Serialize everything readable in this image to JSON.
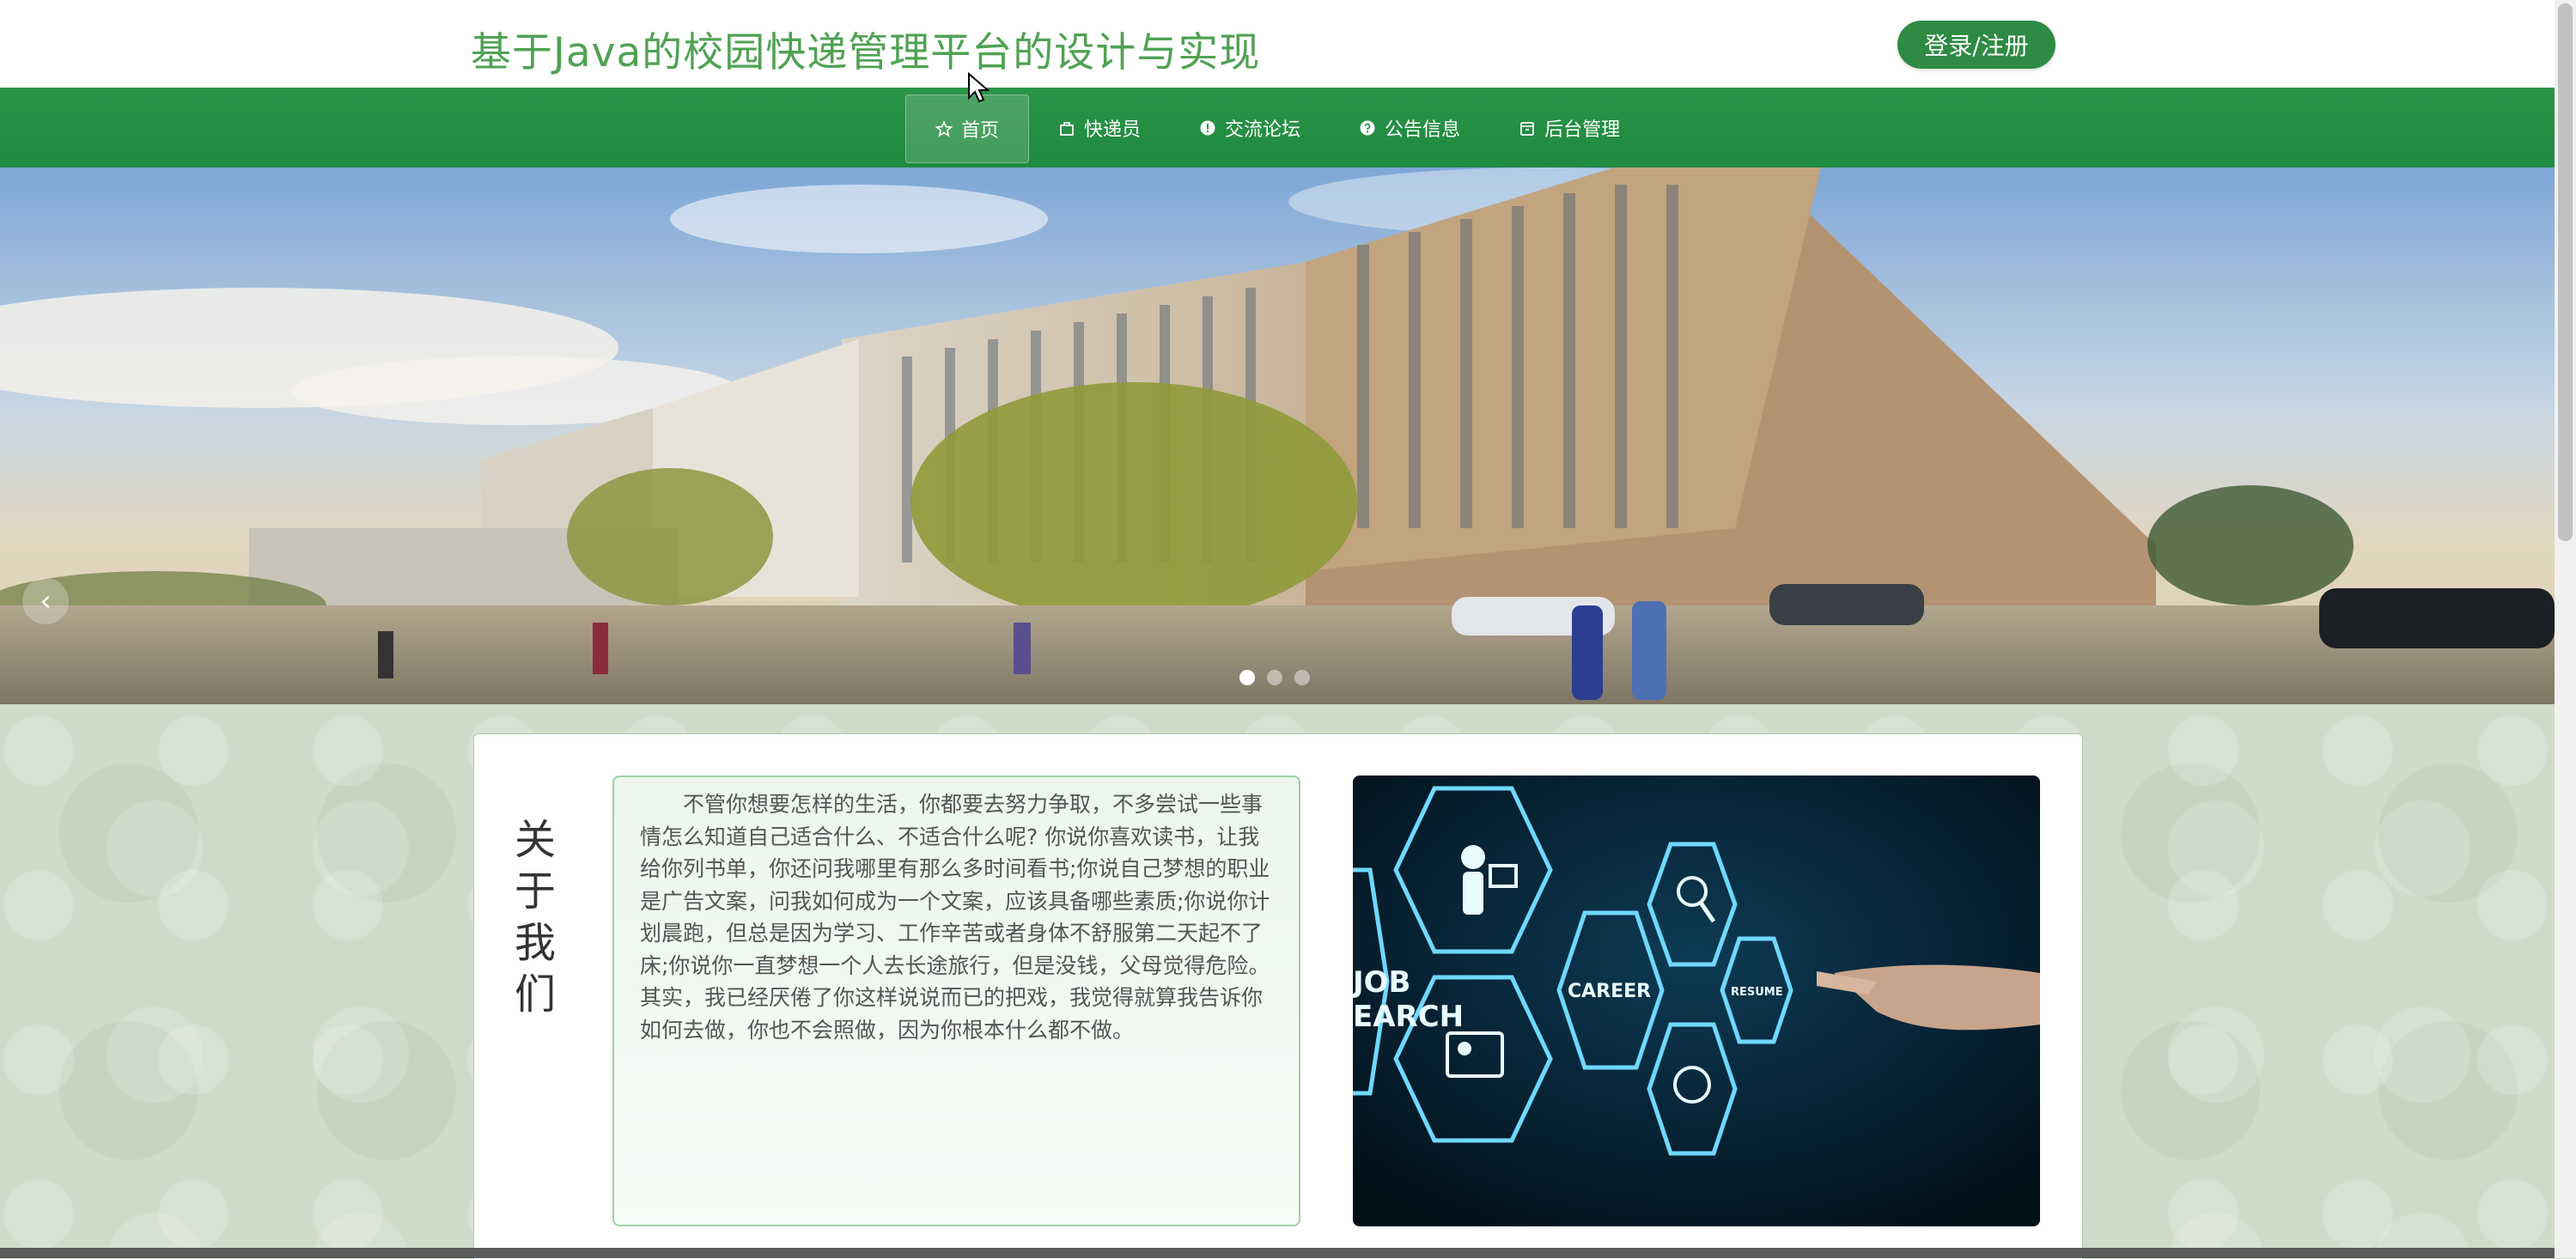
{
  "header": {
    "title": "基于Java的校园快递管理平台的设计与实现",
    "login_label": "登录/注册"
  },
  "nav": {
    "items": [
      {
        "label": "首页",
        "icon": "star-icon",
        "active": true
      },
      {
        "label": "快递员",
        "icon": "bag-icon",
        "active": false
      },
      {
        "label": "交流论坛",
        "icon": "info-circle-icon",
        "active": false
      },
      {
        "label": "公告信息",
        "icon": "question-circle-icon",
        "active": false
      },
      {
        "label": "后台管理",
        "icon": "archive-icon",
        "active": false
      }
    ]
  },
  "banner": {
    "image": "campus-building-photo",
    "prev_icon": "chevron-left-icon",
    "slide_count": 3,
    "active_slide": 1
  },
  "about": {
    "title": "关于我们",
    "text": "不管你想要怎样的生活，你都要去努力争取，不多尝试一些事情怎么知道自己适合什么、不适合什么呢? 你说你喜欢读书，让我给你列书单，你还问我哪里有那么多时间看书;你说自己梦想的职业是广告文案，问我如何成为一个文案，应该具备哪些素质;你说你计划晨跑，但总是因为学习、工作辛苦或者身体不舒服第二天起不了床;你说你一直梦想一个人去长途旅行，但是没钱，父母觉得危险。其实，我已经厌倦了你这样说说而已的把戏，我觉得就算我告诉你如何去做，你也不会照做，因为你根本什么都不做。",
    "image_labels": [
      "JOB",
      "EARCH",
      "CAREER",
      "RESUME"
    ]
  },
  "colors": {
    "primary": "#2e8b43",
    "title_green": "#4fa253",
    "border_green": "#9fd0a6"
  }
}
